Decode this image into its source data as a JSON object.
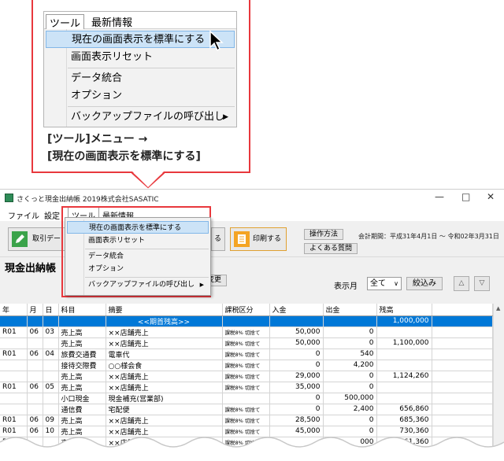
{
  "callout": {
    "menubar": {
      "tool": "ツール",
      "news": "最新情報"
    },
    "items": [
      {
        "label": "現在の画面表示を標準にする"
      },
      {
        "label": "画面表示リセット"
      },
      {
        "label": "データ統合"
      },
      {
        "label": "オプション"
      },
      {
        "label": "バックアップファイルの呼び出し"
      }
    ],
    "caption_line1": "[ツール]メニュー →",
    "caption_line2": "[現在の画面表示を標準にする]"
  },
  "window": {
    "title": "さくっと現金出納帳 2019株式会社SASATIC",
    "controls": {
      "minimize": "—",
      "maximize": "□",
      "close": "✕"
    },
    "menubar": {
      "file": "ファイル",
      "settings": "設定",
      "tool": "ツール",
      "news": "最新情報"
    },
    "toolbar": {
      "input_label": "取引デー",
      "print_label": "印刷する",
      "howto": "操作方法",
      "faq": "よくある質問",
      "period": "会計期間：平成31年4月1日 〜 令和02年3月31日"
    },
    "ledger_title": "現金出納帳",
    "change_label": "変更",
    "month_label": "表示月",
    "month_value": "全て",
    "filter_label": "絞込み",
    "tools_menu": [
      "現在の画面表示を標準にする",
      "画面表示リセット",
      "データ統合",
      "オプション",
      "バックアップファイルの呼び出し"
    ]
  },
  "table": {
    "columns": [
      "年",
      "月",
      "日",
      "科目",
      "摘要",
      "課税区分",
      "入金",
      "出金",
      "残高"
    ],
    "rows": [
      [
        "",
        "",
        "",
        "",
        "<<期首残高>>",
        "",
        "",
        "",
        "1,000,000"
      ],
      [
        "R01",
        "06",
        "03",
        "売上高",
        "××店舗売上",
        "課税8% 切捨て",
        "50,000",
        "0",
        ""
      ],
      [
        "",
        "",
        "",
        "売上高",
        "××店舗売上",
        "課税8% 切捨て",
        "50,000",
        "0",
        "1,100,000"
      ],
      [
        "R01",
        "06",
        "04",
        "旅費交通費",
        "電車代",
        "課税8% 切捨て",
        "0",
        "540",
        ""
      ],
      [
        "",
        "",
        "",
        "接待交際費",
        "○○様会食",
        "課税8% 切捨て",
        "0",
        "4,200",
        ""
      ],
      [
        "",
        "",
        "",
        "売上高",
        "××店舗売上",
        "課税8% 切捨て",
        "29,000",
        "0",
        "1,124,260"
      ],
      [
        "R01",
        "06",
        "05",
        "売上高",
        "××店舗売上",
        "課税8% 切捨て",
        "35,000",
        "0",
        ""
      ],
      [
        "",
        "",
        "",
        "小口現金",
        "現金補充(営業部)",
        "",
        "0",
        "500,000",
        ""
      ],
      [
        "",
        "",
        "",
        "通信費",
        "宅配便",
        "課税8% 切捨て",
        "0",
        "2,400",
        "656,860"
      ],
      [
        "R01",
        "06",
        "09",
        "売上高",
        "××店舗売上",
        "課税8% 切捨て",
        "28,500",
        "0",
        "685,360"
      ],
      [
        "R01",
        "06",
        "10",
        "売上高",
        "××店舗売上",
        "課税8% 切捨て",
        "45,000",
        "0",
        "730,360"
      ],
      [
        "R01",
        "",
        "",
        "売上高",
        "××店舗売上",
        "課税8% 切捨て",
        "",
        "000",
        "761,360"
      ]
    ]
  }
}
